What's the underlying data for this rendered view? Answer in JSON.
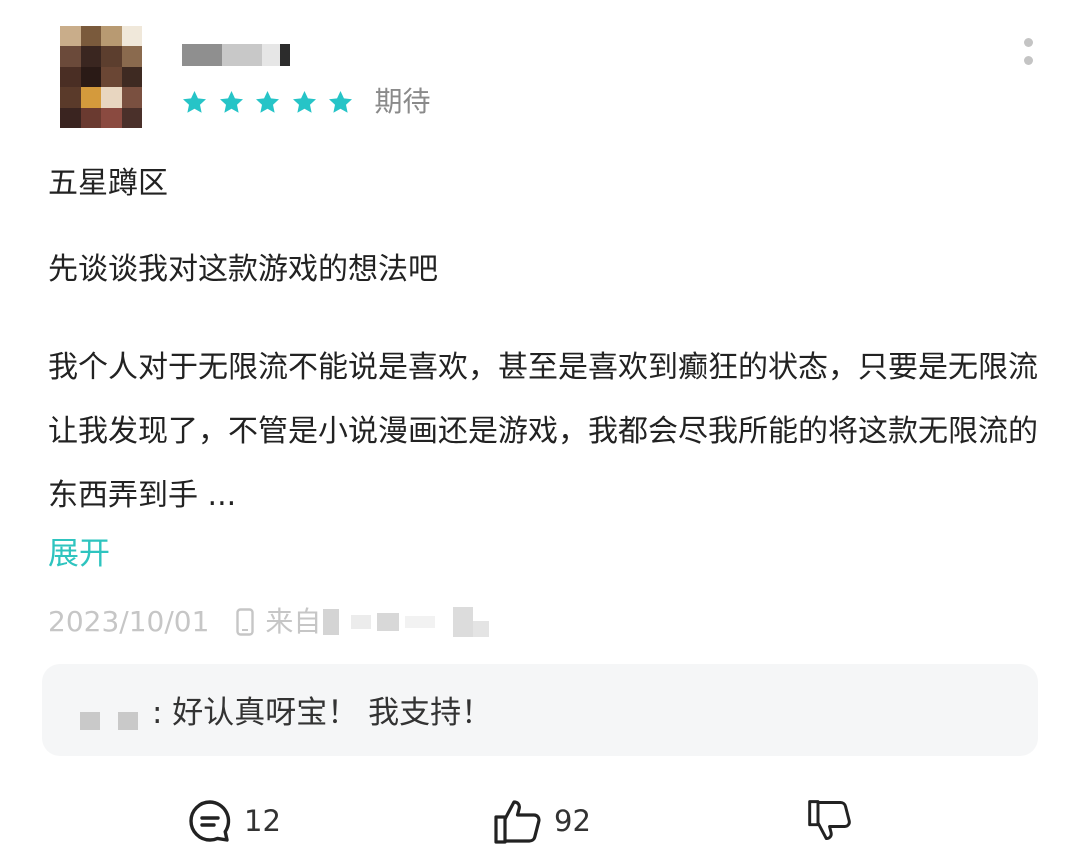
{
  "review": {
    "rating_value": 5,
    "rating_max": 5,
    "rating_label": "期待",
    "title": "五星蹲区",
    "paragraph1": "先谈谈我对这款游戏的想法吧",
    "paragraph2": "我个人对于无限流不能说是喜欢，甚至是喜欢到癫狂的状态，只要是无限流让我发现了，不管是小说漫画还是游戏，我都会尽我所能的将这款无限流的东西弄到手 ...",
    "expand_label": "展开",
    "date": "2023/10/01",
    "source_prefix": "来自"
  },
  "reply": {
    "text": ": 好认真呀宝！ 我支持！"
  },
  "actions": {
    "comment_count": "12",
    "like_count": "92"
  },
  "icons": {
    "avatar": "avatar-image",
    "star": "star-icon",
    "more": "more-vertical-icon",
    "device": "phone-icon",
    "comment": "comment-bubble-icon",
    "like": "thumbs-up-icon",
    "dislike": "thumbs-down-icon"
  },
  "colors": {
    "accent": "#2ec4bf",
    "star": "#26c4c7",
    "meta_text": "#c6c6c6",
    "reply_bg": "#f5f6f7"
  }
}
